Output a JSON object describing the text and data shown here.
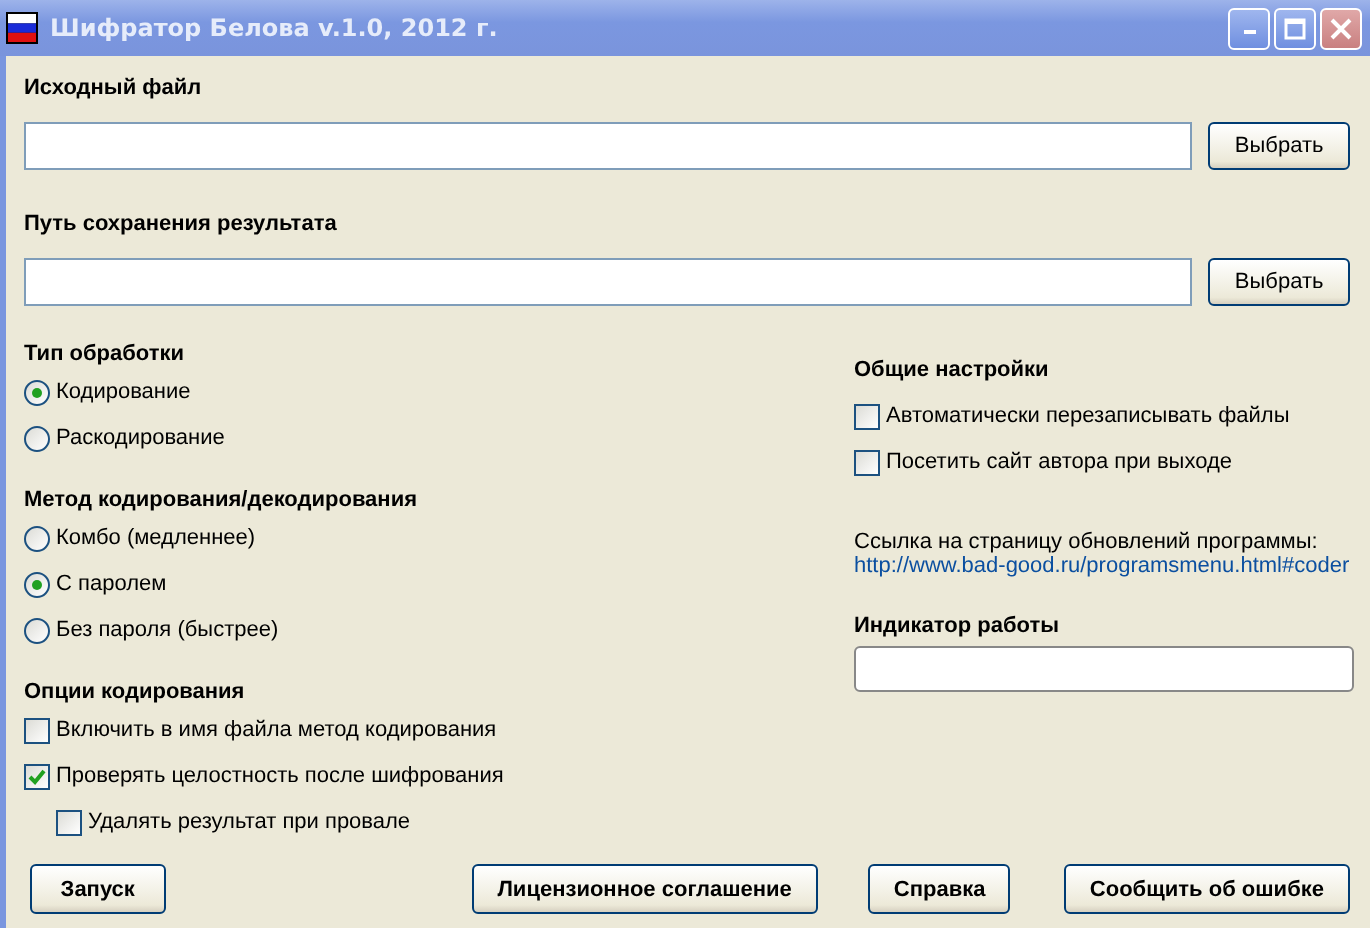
{
  "window": {
    "title": "Шифратор Белова v.1.0, 2012 г."
  },
  "source_file": {
    "label": "Исходный файл",
    "button": "Выбрать"
  },
  "output_path": {
    "label": "Путь сохранения результата",
    "button": "Выбрать"
  },
  "processing_type": {
    "title": "Тип обработки",
    "options": [
      {
        "label": "Кодирование",
        "selected": true
      },
      {
        "label": "Раскодирование",
        "selected": false
      }
    ]
  },
  "method": {
    "title": "Метод кодирования/декодирования",
    "options": [
      {
        "label": "Комбо (медленнее)",
        "selected": false
      },
      {
        "label": "С паролем",
        "selected": true
      },
      {
        "label": "Без пароля (быстрее)",
        "selected": false
      }
    ]
  },
  "encoding_options": {
    "title": "Опции кодирования",
    "items": [
      {
        "label": "Включить в имя файла метод кодирования",
        "checked": false
      },
      {
        "label": "Проверять целостность после шифрования",
        "checked": true,
        "children": [
          {
            "label": "Удалять результат при провале",
            "checked": false
          }
        ]
      }
    ]
  },
  "general_settings": {
    "title": "Общие настройки",
    "items": [
      {
        "label": "Автоматически перезаписывать файлы",
        "checked": false
      },
      {
        "label": "Посетить сайт автора при выходе",
        "checked": false
      }
    ]
  },
  "update_link": {
    "text": "Ссылка на страницу обновлений программы:",
    "url": "http://www.bad-good.ru/programsmenu.html#coder"
  },
  "progress": {
    "label": "Индикатор работы",
    "level": 0
  },
  "buttons": [
    "Запуск",
    "Лицензионное соглашение",
    "Справка",
    "Сообщить об ошибке"
  ]
}
